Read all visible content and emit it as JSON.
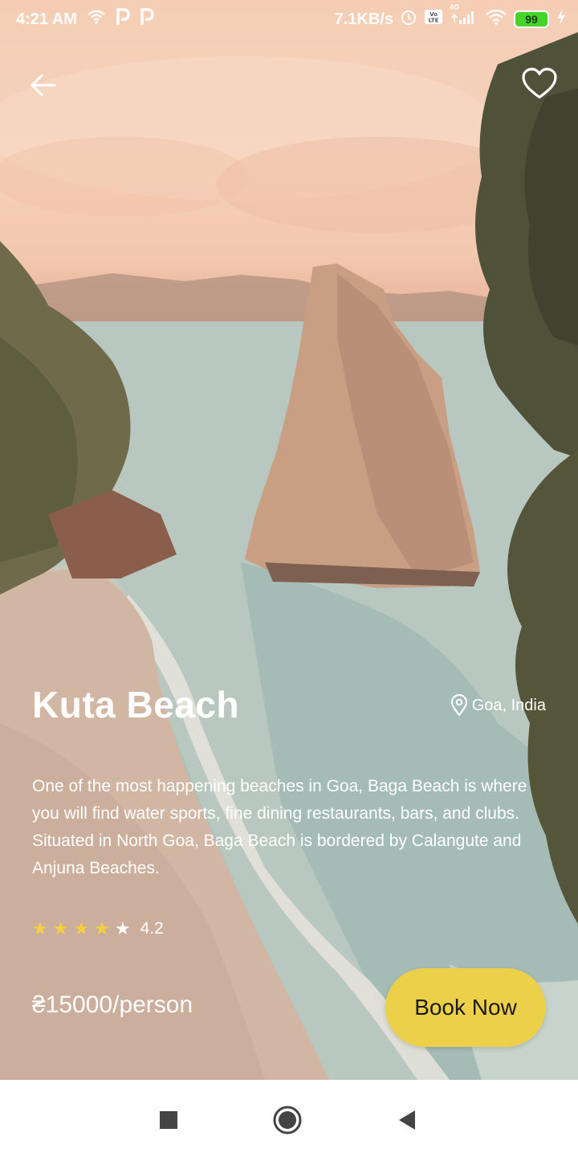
{
  "status_bar": {
    "time": "4:21 AM",
    "notif_icons": [
      "wifi-icon",
      "p-app-icon",
      "p-app-icon"
    ],
    "net_speed": "7.1KB/s",
    "sys_icons": [
      "alarm-icon",
      "volte-icon",
      "signal-icon",
      "wifi-icon"
    ],
    "network_type": "4G",
    "battery": "99"
  },
  "place": {
    "title": "Kuta Beach",
    "location": "Goa, India",
    "description": "One of the most happening beaches in Goa, Baga Beach is where you will find water sports, fine dining restaurants, bars, and clubs. Situated in North Goa, Baga Beach is bordered by Calangute and Anjuna Beaches.",
    "rating": "4.2",
    "stars_filled": 4,
    "stars_total": 5,
    "price": "₴15000/person",
    "book_label": "Book Now"
  },
  "colors": {
    "accent": "#ecd04a",
    "star": "#f4d03f",
    "text": "#ffffff"
  },
  "nav_icons": [
    "square-recents-icon",
    "circle-home-icon",
    "triangle-back-icon"
  ]
}
